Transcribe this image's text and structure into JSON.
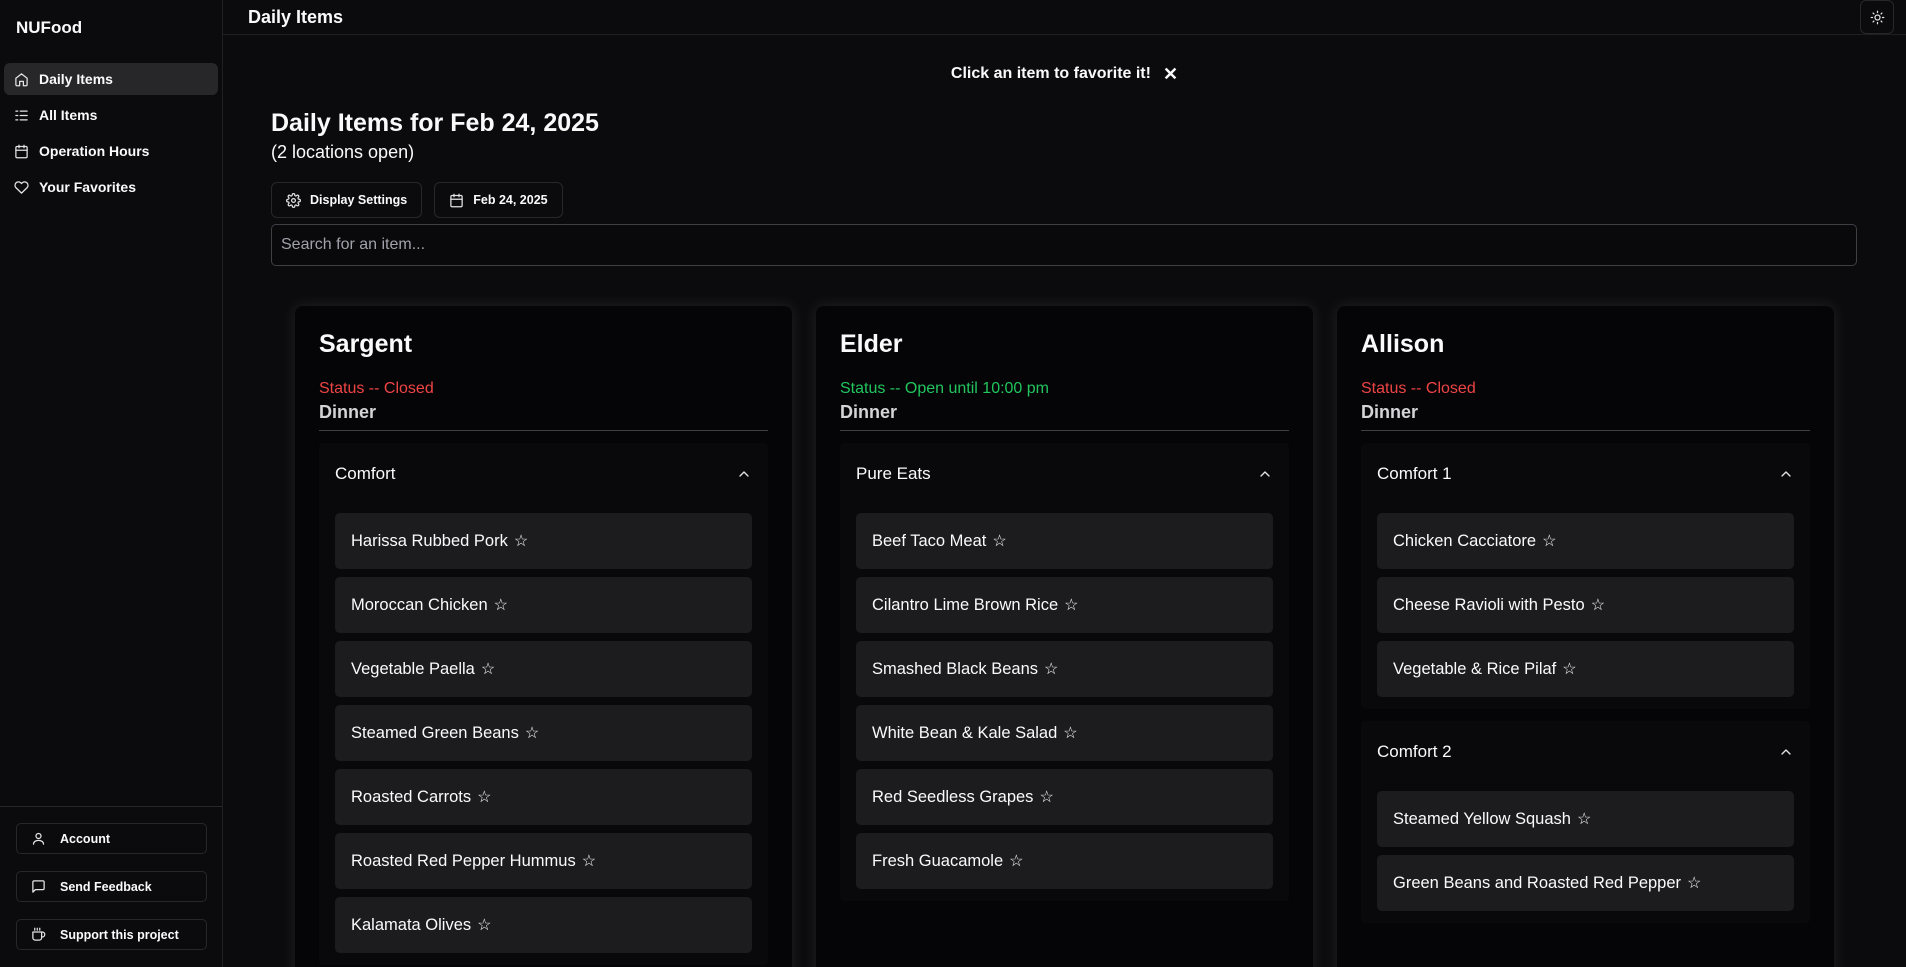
{
  "app": {
    "brand": "NUFood"
  },
  "sidebar": {
    "items": [
      {
        "label": "Daily Items",
        "icon": "home-icon",
        "active": true
      },
      {
        "label": "All Items",
        "icon": "list-icon"
      },
      {
        "label": "Operation Hours",
        "icon": "calendar-icon"
      },
      {
        "label": "Your Favorites",
        "icon": "heart-icon"
      }
    ],
    "footer": [
      {
        "label": "Account",
        "icon": "user-icon"
      },
      {
        "label": "Send Feedback",
        "icon": "message-icon"
      },
      {
        "label": "Support this project",
        "icon": "coffee-icon"
      }
    ]
  },
  "header": {
    "title": "Daily Items",
    "theme_icon": "sun-icon"
  },
  "banner": {
    "text": "Click an item to favorite it!",
    "close": "✕"
  },
  "page": {
    "heading": "Daily Items for Feb 24, 2025",
    "subheading": "(2 locations open)",
    "display_settings_label": "Display Settings",
    "date_label": "Feb 24, 2025",
    "search_placeholder": "Search for an item..."
  },
  "locations": [
    {
      "name": "Sargent",
      "status": "Status -- Closed",
      "status_color": "#ef4444",
      "meal": "Dinner",
      "stations": [
        {
          "name": "Comfort",
          "items": [
            "Harissa Rubbed Pork",
            "Moroccan Chicken",
            "Vegetable Paella",
            "Steamed Green Beans",
            "Roasted Carrots",
            "Roasted Red Pepper Hummus",
            "Kalamata Olives"
          ]
        }
      ]
    },
    {
      "name": "Elder",
      "status": "Status -- Open until 10:00 pm",
      "status_color": "#22c55e",
      "meal": "Dinner",
      "stations": [
        {
          "name": "Pure Eats",
          "items": [
            "Beef Taco Meat",
            "Cilantro Lime Brown Rice",
            "Smashed Black Beans",
            "White Bean & Kale Salad",
            "Red Seedless Grapes",
            "Fresh Guacamole"
          ]
        }
      ]
    },
    {
      "name": "Allison",
      "status": "Status -- Closed",
      "status_color": "#ef4444",
      "meal": "Dinner",
      "stations": [
        {
          "name": "Comfort 1",
          "items": [
            "Chicken Cacciatore",
            "Cheese Ravioli with Pesto",
            "Vegetable & Rice Pilaf"
          ]
        },
        {
          "name": "Comfort 2",
          "items": [
            "Steamed Yellow Squash",
            "Green Beans and Roasted Red Pepper"
          ]
        }
      ]
    }
  ],
  "star_glyph": "☆"
}
